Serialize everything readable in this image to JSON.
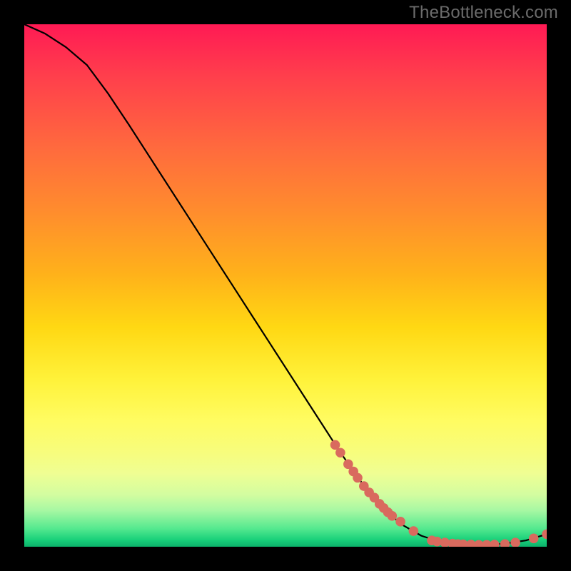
{
  "watermark": "TheBottleneck.com",
  "colors": {
    "curve": "#000000",
    "marker_fill": "#d96a5e",
    "marker_stroke": "#a8463c",
    "background": "#000000"
  },
  "chart_data": {
    "type": "line",
    "title": "",
    "xlabel": "",
    "ylabel": "",
    "xlim": [
      0,
      100
    ],
    "ylim": [
      0,
      100
    ],
    "curve": {
      "x": [
        0,
        4,
        8,
        12,
        16,
        20,
        24,
        28,
        32,
        36,
        40,
        44,
        48,
        52,
        56,
        60,
        64,
        68,
        72,
        76,
        80,
        84,
        88,
        92,
        96,
        100
      ],
      "y": [
        100,
        98.2,
        95.6,
        92.2,
        86.8,
        80.8,
        74.6,
        68.4,
        62.2,
        56.0,
        49.8,
        43.6,
        37.4,
        31.2,
        25.0,
        18.8,
        13.0,
        8.2,
        4.4,
        2.1,
        0.8,
        0.4,
        0.3,
        0.6,
        1.2,
        2.4
      ]
    },
    "series": [
      {
        "name": "markers",
        "type": "scatter",
        "x": [
          59.5,
          60.5,
          62.0,
          63.0,
          63.8,
          65.0,
          66.0,
          67.0,
          68.0,
          68.8,
          69.6,
          70.4,
          72.0,
          74.5,
          78.0,
          79.0,
          80.5,
          82.0,
          83.0,
          84.0,
          85.5,
          87.0,
          88.5,
          90.0,
          92.0,
          94.0,
          97.5,
          100.0
        ],
        "y": [
          19.5,
          18.0,
          15.8,
          14.4,
          13.2,
          11.6,
          10.4,
          9.4,
          8.2,
          7.4,
          6.6,
          5.9,
          4.8,
          3.0,
          1.2,
          1.0,
          0.8,
          0.6,
          0.5,
          0.45,
          0.4,
          0.35,
          0.35,
          0.4,
          0.5,
          0.8,
          1.6,
          2.4
        ]
      }
    ]
  }
}
